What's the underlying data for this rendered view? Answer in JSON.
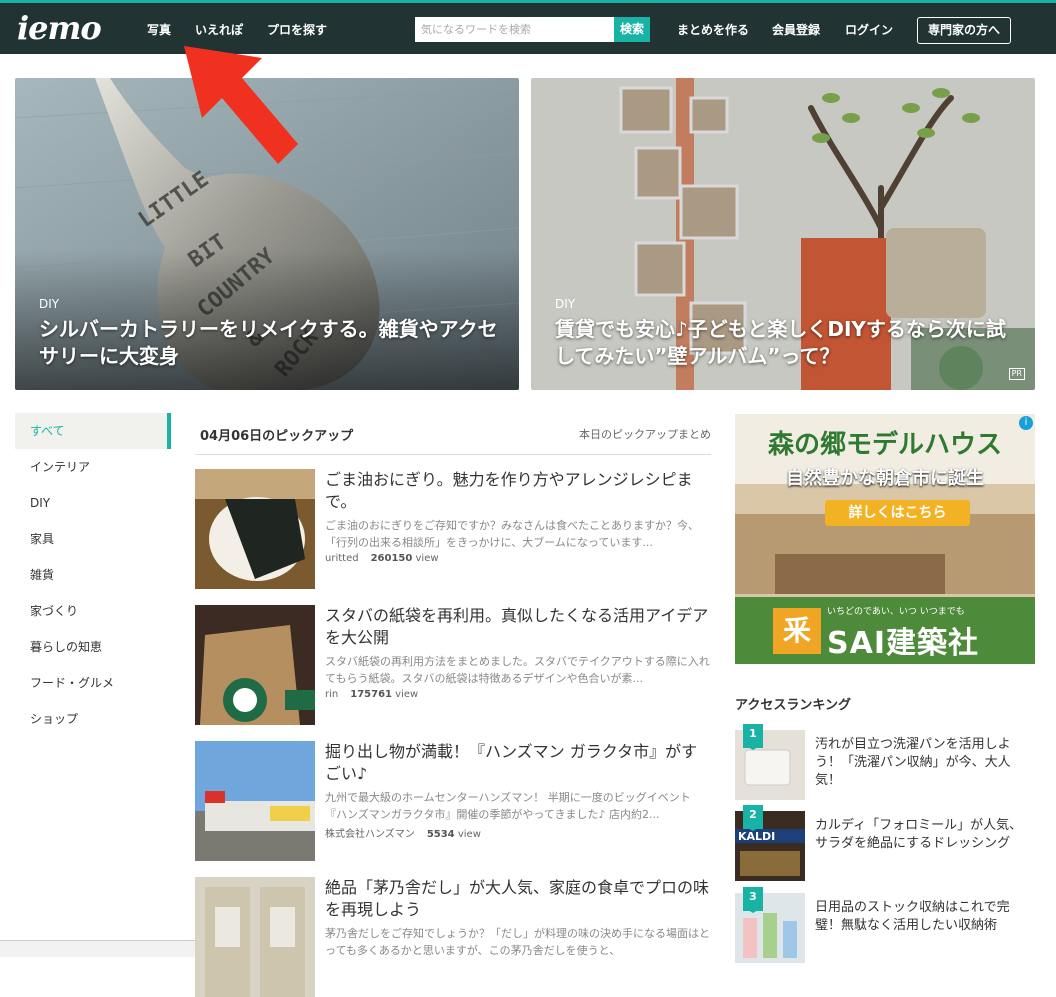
{
  "header": {
    "logo": "iemo",
    "nav": [
      "写真",
      "いえれぽ",
      "プロを探す"
    ],
    "search_placeholder": "気になるワードを検索",
    "search_button": "検索",
    "right_links": [
      "まとめを作る",
      "会員登録",
      "ログイン"
    ],
    "pro_button": "専門家の方へ"
  },
  "hero": [
    {
      "category": "DIY",
      "title": "シルバーカトラリーをリメイクする。雑貨やアクセサリーに大変身"
    },
    {
      "category": "DIY",
      "title": "賃貸でも安心♪子どもと楽しくDIYするなら次に試してみたい”壁アルバム”って？",
      "badge": "PR"
    }
  ],
  "sidebar": {
    "items": [
      "すべて",
      "インテリア",
      "DIY",
      "家具",
      "雑貨",
      "家づくり",
      "暮らしの知恵",
      "フード・グルメ",
      "ショップ"
    ]
  },
  "pickup": {
    "heading": "04月06日のピックアップ",
    "summary_link": "本日のピックアップまとめ",
    "articles": [
      {
        "title": "ごま油おにぎり。魅力を作り方やアレンジレシピまで。",
        "desc": "ごま油のおにぎりをご存知ですか？みなさんは食べたことありますか？今、「行列の出来る相談所」をきっかけに、大ブームになっています...",
        "author": "uritted",
        "views": "260150",
        "view_label": "view"
      },
      {
        "title": "スタバの紙袋を再利用。真似したくなる活用アイデアを大公開",
        "desc": "スタバ紙袋の再利用方法をまとめました。スタバでテイクアウトする際に入れてもらう紙袋。スタバの紙袋は特徴あるデザインや色合いが素...",
        "author": "rin",
        "views": "175761",
        "view_label": "view"
      },
      {
        "title": "掘り出し物が満載！『ハンズマン ガラクタ市』がすごい♪",
        "desc": "九州で最大級のホームセンターハンズマン！ 半期に一度のビッグイベント『ハンズマンガラクタ市』開催の季節がやってきました♪ 店内約2...",
        "author": "株式会社ハンズマン",
        "views": "5534",
        "view_label": "view"
      },
      {
        "title": "絶品「茅乃舎だし」が大人気、家庭の食卓でプロの味を再現しよう",
        "desc": "茅乃舎だしをご存知でしょうか？「だし」が料理の味の決め手になる場面はとっても多くあるかと思いますが、この茅乃舎だしを使うと、",
        "author": "",
        "views": "",
        "view_label": ""
      }
    ]
  },
  "ad": {
    "headline": "森の郷モデルハウス",
    "sub": "自然豊かな朝倉市に誕生",
    "cta": "詳しくはこちら",
    "tagline": "いちどのであい、いつ いつまでも",
    "brand": "SAI建築社",
    "brand_mark": "釆"
  },
  "ranking": {
    "heading": "アクセスランキング",
    "items": [
      {
        "rank": "1",
        "title": "汚れが目立つ洗濯パンを活用しよう！「洗濯パン収納」が今、大人気！"
      },
      {
        "rank": "2",
        "title": "カルディ「フォロミール」が人気、サラダを絶品にするドレッシング"
      },
      {
        "rank": "3",
        "title": "日用品のストック収納はこれで完璧！無駄なく活用したい収納術"
      }
    ],
    "thumb_text_kaldi": "KALDI"
  },
  "colors": {
    "topbar": "#223333",
    "accent": "#19b3a6",
    "arrow": "#f0311f"
  }
}
